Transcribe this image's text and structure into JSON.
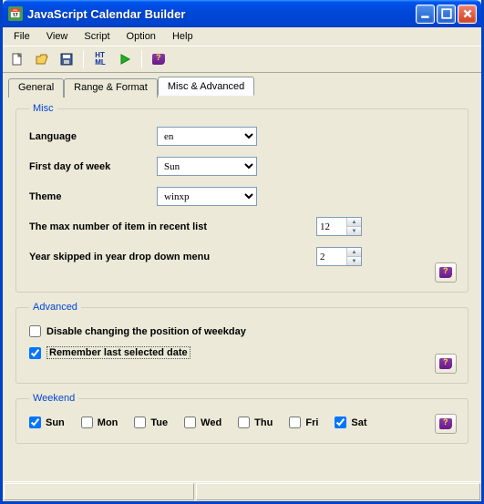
{
  "window": {
    "title": "JavaScript Calendar Builder"
  },
  "menu": {
    "file": "File",
    "view": "View",
    "script": "Script",
    "option": "Option",
    "help": "Help"
  },
  "tabs": {
    "general": "General",
    "range": "Range & Format",
    "misc": "Misc & Advanced"
  },
  "misc": {
    "legend": "Misc",
    "language_label": "Language",
    "language_value": "en",
    "firstday_label": "First day of week",
    "firstday_value": "Sun",
    "theme_label": "Theme",
    "theme_value": "winxp",
    "maxrecent_label": "The max number of item in recent list",
    "maxrecent_value": "12",
    "yearskip_label": "Year skipped in year drop down menu",
    "yearskip_value": "2"
  },
  "advanced": {
    "legend": "Advanced",
    "disable_pos": "Disable changing the position of weekday",
    "disable_pos_checked": false,
    "remember": "Remember last selected date",
    "remember_checked": true
  },
  "weekend": {
    "legend": "Weekend",
    "days": [
      {
        "label": "Sun",
        "checked": true
      },
      {
        "label": "Mon",
        "checked": false
      },
      {
        "label": "Tue",
        "checked": false
      },
      {
        "label": "Wed",
        "checked": false
      },
      {
        "label": "Thu",
        "checked": false
      },
      {
        "label": "Fri",
        "checked": false
      },
      {
        "label": "Sat",
        "checked": true
      }
    ]
  }
}
